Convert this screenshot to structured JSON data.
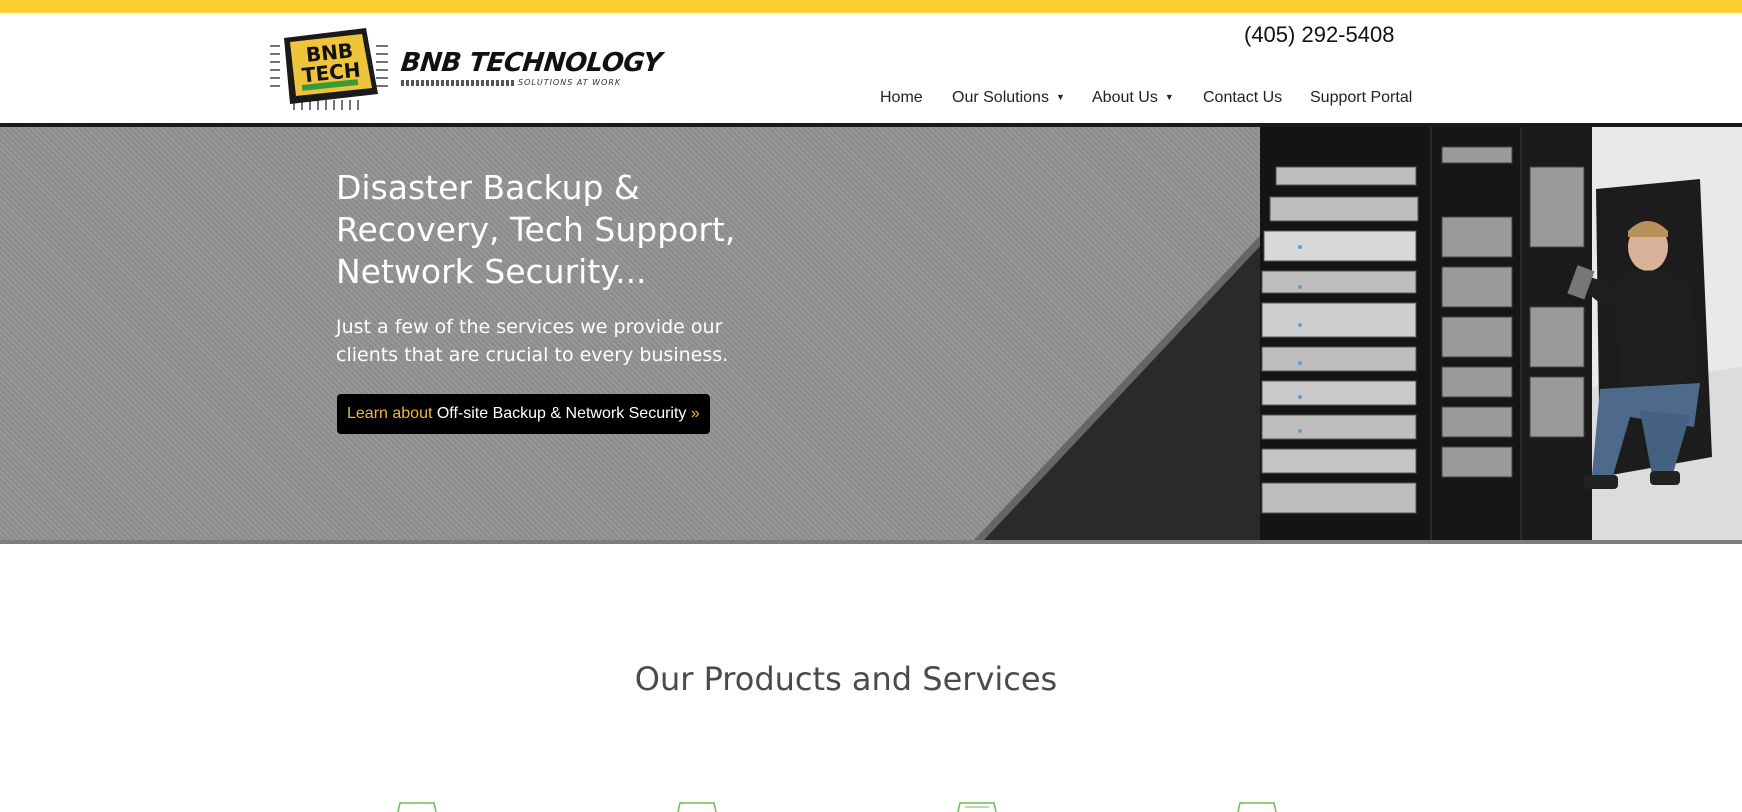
{
  "brand": {
    "chip_text_line1": "BNB",
    "chip_text_line2": "TECH",
    "name": "BNB TECHNOLOGY",
    "tagline": "SOLUTIONS AT WORK"
  },
  "header": {
    "phone": "(405) 292-5408"
  },
  "nav": {
    "items": [
      {
        "label": "Home",
        "has_dropdown": false
      },
      {
        "label": "Our Solutions",
        "has_dropdown": true
      },
      {
        "label": "About Us",
        "has_dropdown": true
      },
      {
        "label": "Contact Us",
        "has_dropdown": false
      },
      {
        "label": "Support Portal",
        "has_dropdown": false
      }
    ],
    "caret": "▼"
  },
  "hero": {
    "title": "Disaster Backup & Recovery, Tech Support, Network Security...",
    "subtitle": "Just a few of the services we provide our clients that are crucial to every business.",
    "cta_prefix": "Learn about ",
    "cta_main": "Off-site Backup & Network Security ",
    "cta_suffix": "»"
  },
  "products": {
    "title": "Our Products and Services",
    "icon_count": 4
  },
  "colors": {
    "top_bar": "#fdd02f",
    "hero_bg": "#929292",
    "cta_accent": "#f0b73a",
    "icon_green": "#6abf4b"
  }
}
